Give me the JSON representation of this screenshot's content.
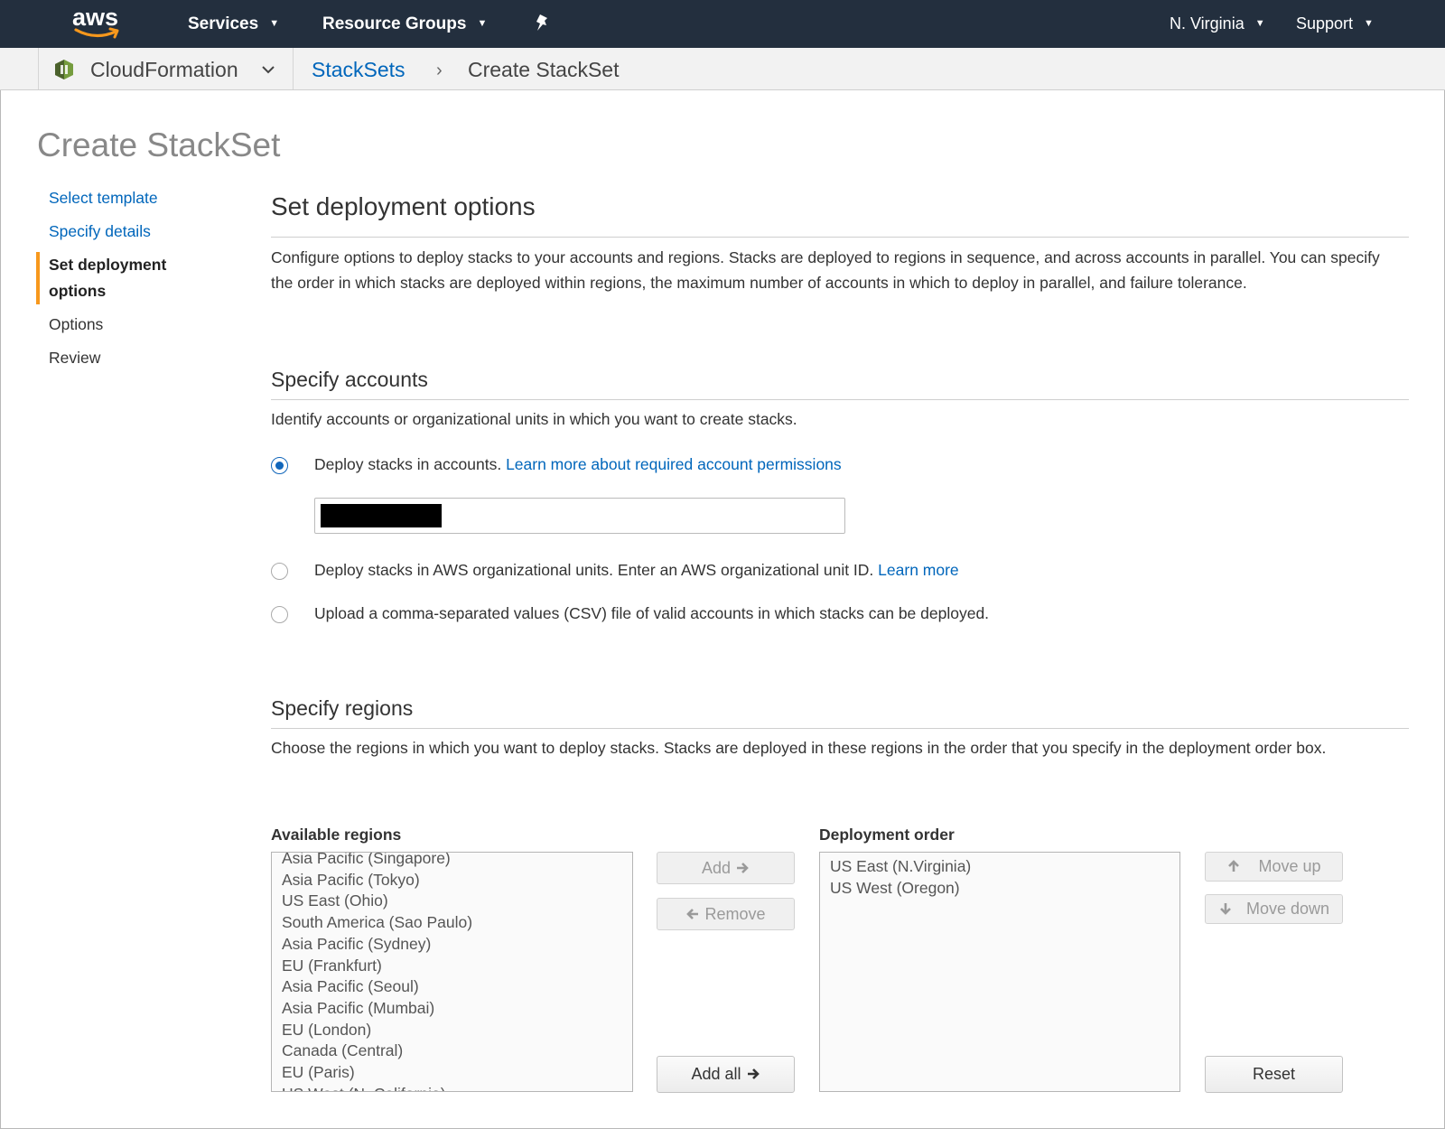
{
  "topnav": {
    "logo": "aws",
    "services": "Services",
    "resource_groups": "Resource Groups",
    "region": "N. Virginia",
    "support": "Support"
  },
  "breadcrumb": {
    "service": "CloudFormation",
    "parent": "StackSets",
    "current": "Create StackSet"
  },
  "page_title": "Create StackSet",
  "steps": [
    {
      "label": "Select template"
    },
    {
      "label": "Specify details"
    },
    {
      "label": "Set deployment options"
    },
    {
      "label": "Options"
    },
    {
      "label": "Review"
    }
  ],
  "section": {
    "title": "Set deployment options",
    "description": "Configure options to deploy stacks to your accounts and regions. Stacks are deployed to regions in sequence, and across accounts in parallel. You can specify the order in which stacks are deployed within regions, the maximum number of accounts in which to deploy in parallel, and failure tolerance."
  },
  "accounts": {
    "title": "Specify accounts",
    "description": "Identify accounts or organizational units in which you want to create stacks.",
    "option_accounts": "Deploy stacks in accounts.",
    "option_accounts_link": "Learn more about required account permissions",
    "option_ou": "Deploy stacks in AWS organizational units. Enter an AWS organizational unit ID.",
    "option_ou_link": "Learn more",
    "option_csv": "Upload a comma-separated values (CSV) file of valid accounts in which stacks can be deployed.",
    "selected": "accounts"
  },
  "regions": {
    "title": "Specify regions",
    "description": "Choose the regions in which you want to deploy stacks. Stacks are deployed in these regions in the order that you specify in the deployment order box.",
    "available_label": "Available regions",
    "available": [
      "Asia Pacific (Singapore)",
      "Asia Pacific (Tokyo)",
      "US East (Ohio)",
      "South America (Sao Paulo)",
      "Asia Pacific (Sydney)",
      "EU (Frankfurt)",
      "Asia Pacific (Seoul)",
      "Asia Pacific (Mumbai)",
      "EU (London)",
      "Canada (Central)",
      "EU (Paris)",
      "US West (N. California)"
    ],
    "order_label": "Deployment order",
    "order": [
      "US East (N.Virginia)",
      "US West (Oregon)"
    ],
    "add": "Add",
    "remove": "Remove",
    "add_all": "Add all",
    "move_up": "Move up",
    "move_down": "Move down",
    "reset": "Reset"
  }
}
